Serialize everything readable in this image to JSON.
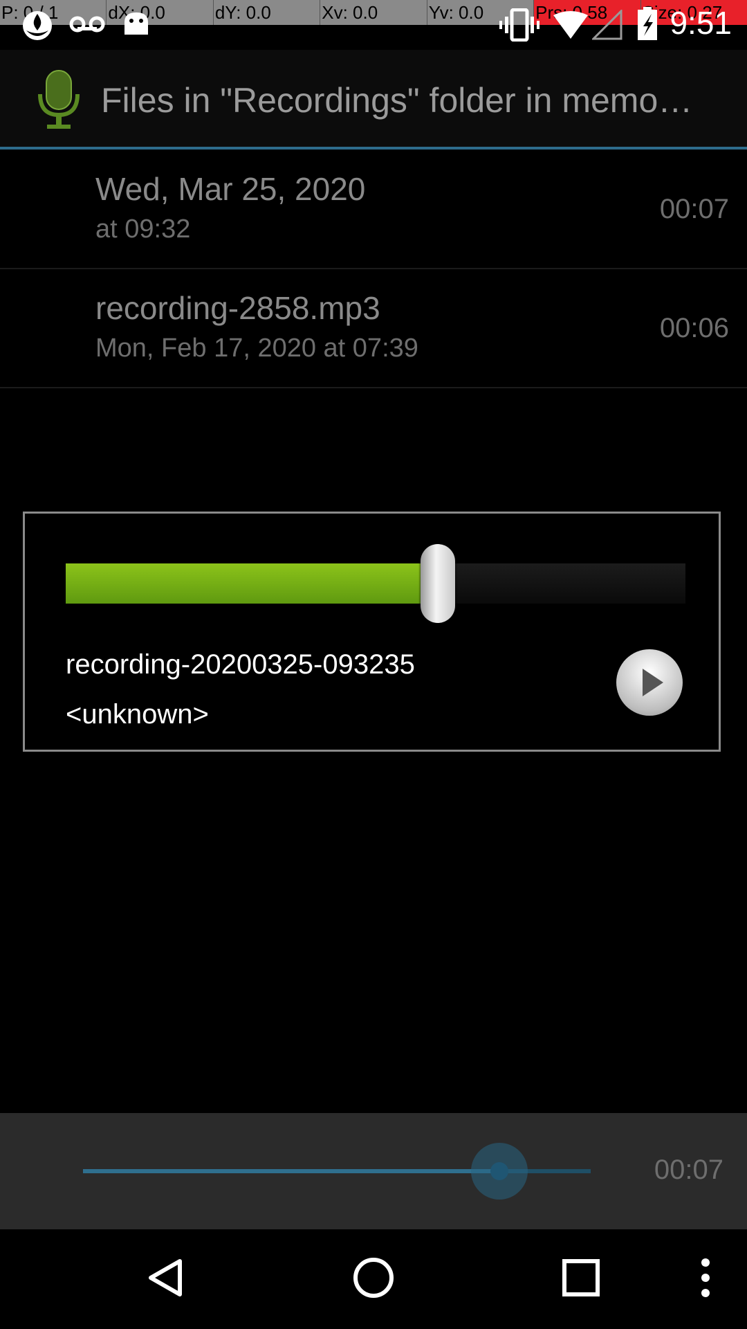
{
  "debug_overlay": {
    "pointer": "P: 0 / 1",
    "dx": "dX: 0.0",
    "dy": "dY: 0.0",
    "xv": "Xv: 0.0",
    "yv": "Yv: 0.0",
    "pressure": "Prs: 0.58",
    "size": "Size: 0.27",
    "highlight_color": "#e8212a"
  },
  "status_bar": {
    "time": "9:51",
    "left_icons": [
      "flame-icon",
      "voicemail-icon",
      "android-icon"
    ],
    "right_icons": [
      "vibrate-icon",
      "wifi-icon",
      "signal-icon",
      "battery-icon"
    ]
  },
  "action_bar": {
    "icon": "microphone-icon",
    "title": "Files in \"Recordings\" folder in memo…",
    "accent_color": "#2e6c8c"
  },
  "recordings": [
    {
      "title": "Wed, Mar 25, 2020",
      "subtitle": "at 09:32",
      "duration": "00:07"
    },
    {
      "title": "recording-2858.mp3",
      "subtitle": "Mon, Feb 17, 2020 at 07:39",
      "duration": "00:06"
    }
  ],
  "player_dialog": {
    "title": "recording-20200325-093235",
    "artist": "<unknown>",
    "progress": 0.6,
    "fill_color": "#7ab51a",
    "play_icon": "play-icon"
  },
  "bottom_player": {
    "time": "00:07",
    "progress": 0.82
  },
  "nav_bar": {
    "buttons": [
      "back-icon",
      "home-icon",
      "recents-icon",
      "overflow-menu-icon"
    ]
  }
}
